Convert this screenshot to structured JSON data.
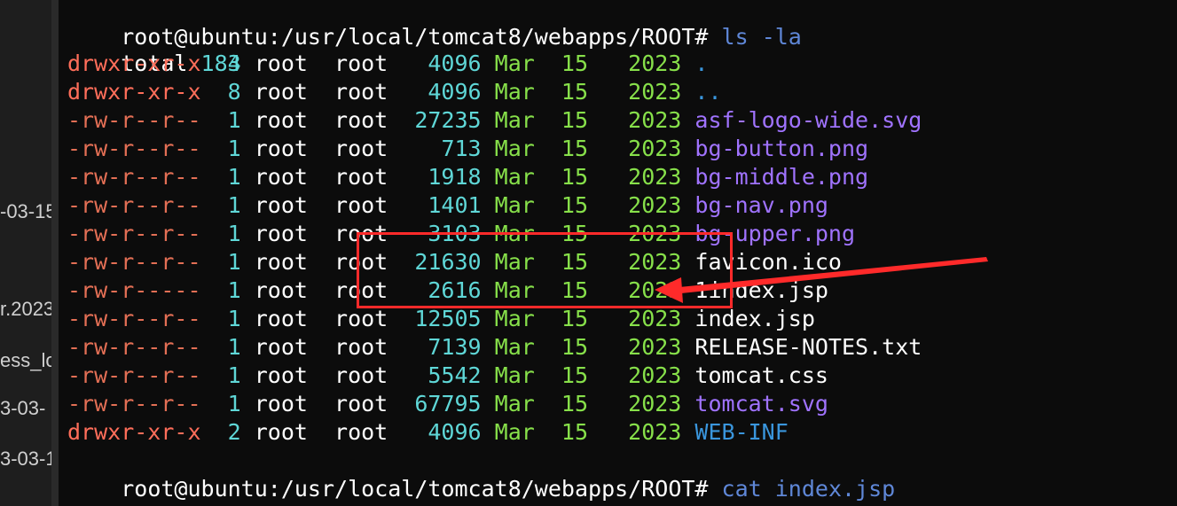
{
  "sidebar": {
    "fragments": [
      "-03-15",
      "r.2023",
      "ess_lo",
      "3-03-",
      "3-03-1"
    ]
  },
  "terminal": {
    "prompt1": "root@ubuntu:/usr/local/tomcat8/webapps/ROOT#",
    "cmd1": "ls -la",
    "total_label": "total",
    "total_value": "184",
    "entries": [
      {
        "perm": "drwxr-xr-x",
        "links": "3",
        "user": "root",
        "group": "root",
        "size": "4096",
        "month": "Mar",
        "day": "15",
        "year": "2023",
        "name": ".",
        "kind": "dir"
      },
      {
        "perm": "drwxr-xr-x",
        "links": "8",
        "user": "root",
        "group": "root",
        "size": "4096",
        "month": "Mar",
        "day": "15",
        "year": "2023",
        "name": "..",
        "kind": "dir"
      },
      {
        "perm": "-rw-r--r--",
        "links": "1",
        "user": "root",
        "group": "root",
        "size": "27235",
        "month": "Mar",
        "day": "15",
        "year": "2023",
        "name": "asf-logo-wide.svg",
        "kind": "image"
      },
      {
        "perm": "-rw-r--r--",
        "links": "1",
        "user": "root",
        "group": "root",
        "size": "713",
        "month": "Mar",
        "day": "15",
        "year": "2023",
        "name": "bg-button.png",
        "kind": "image"
      },
      {
        "perm": "-rw-r--r--",
        "links": "1",
        "user": "root",
        "group": "root",
        "size": "1918",
        "month": "Mar",
        "day": "15",
        "year": "2023",
        "name": "bg-middle.png",
        "kind": "image"
      },
      {
        "perm": "-rw-r--r--",
        "links": "1",
        "user": "root",
        "group": "root",
        "size": "1401",
        "month": "Mar",
        "day": "15",
        "year": "2023",
        "name": "bg-nav.png",
        "kind": "image"
      },
      {
        "perm": "-rw-r--r--",
        "links": "1",
        "user": "root",
        "group": "root",
        "size": "3103",
        "month": "Mar",
        "day": "15",
        "year": "2023",
        "name": "bg-upper.png",
        "kind": "image"
      },
      {
        "perm": "-rw-r--r--",
        "links": "1",
        "user": "root",
        "group": "root",
        "size": "21630",
        "month": "Mar",
        "day": "15",
        "year": "2023",
        "name": "favicon.ico",
        "kind": "plain"
      },
      {
        "perm": "-rw-r-----",
        "links": "1",
        "user": "root",
        "group": "root",
        "size": "2616",
        "month": "Mar",
        "day": "15",
        "year": "2023",
        "name": "1index.jsp",
        "kind": "plain"
      },
      {
        "perm": "-rw-r--r--",
        "links": "1",
        "user": "root",
        "group": "root",
        "size": "12505",
        "month": "Mar",
        "day": "15",
        "year": "2023",
        "name": "index.jsp",
        "kind": "plain"
      },
      {
        "perm": "-rw-r--r--",
        "links": "1",
        "user": "root",
        "group": "root",
        "size": "7139",
        "month": "Mar",
        "day": "15",
        "year": "2023",
        "name": "RELEASE-NOTES.txt",
        "kind": "plain"
      },
      {
        "perm": "-rw-r--r--",
        "links": "1",
        "user": "root",
        "group": "root",
        "size": "5542",
        "month": "Mar",
        "day": "15",
        "year": "2023",
        "name": "tomcat.css",
        "kind": "plain"
      },
      {
        "perm": "-rw-r--r--",
        "links": "1",
        "user": "root",
        "group": "root",
        "size": "67795",
        "month": "Mar",
        "day": "15",
        "year": "2023",
        "name": "tomcat.svg",
        "kind": "image"
      },
      {
        "perm": "drwxr-xr-x",
        "links": "2",
        "user": "root",
        "group": "root",
        "size": "4096",
        "month": "Mar",
        "day": "15",
        "year": "2023",
        "name": "WEB-INF",
        "kind": "dir"
      }
    ],
    "prompt2": "root@ubuntu:/usr/local/tomcat8/webapps/ROOT#",
    "cmd2": "cat index.jsp",
    "output_line": "<%--"
  },
  "colors": {
    "background": "#0c0c0c",
    "permissions": "#e36f55",
    "numbers": "#5fd7d7",
    "dates": "#87e04a",
    "directories": "#3a96dd",
    "images": "#a073ff",
    "command": "#5f87d7",
    "annotation": "#ff2a2a"
  }
}
